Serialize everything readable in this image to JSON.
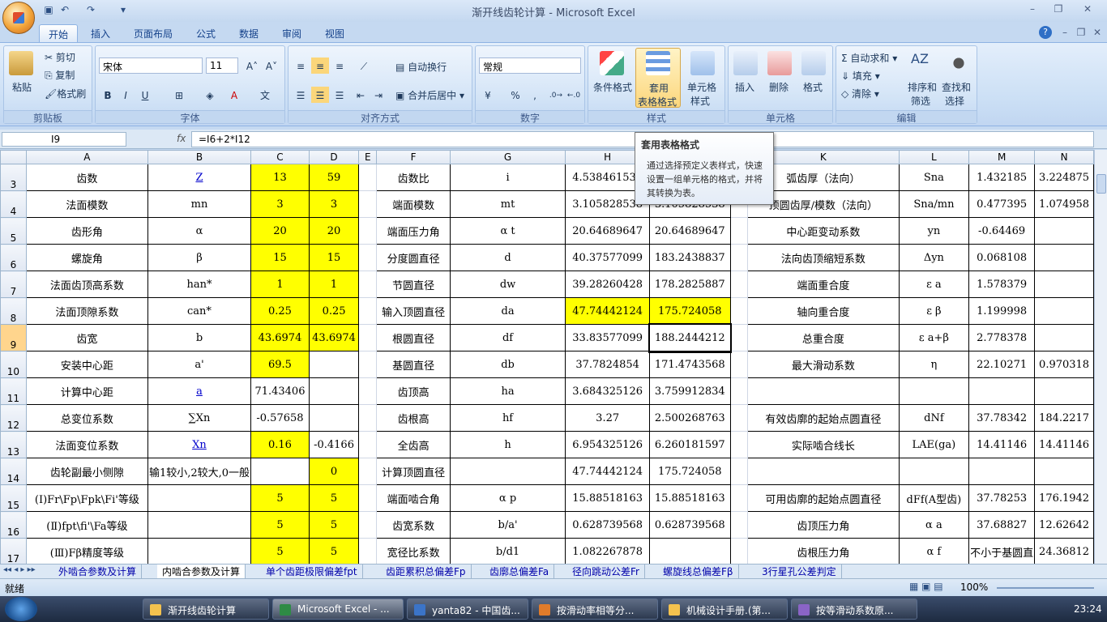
{
  "title": "渐开线齿轮计算 - Microsoft Excel",
  "tabs": [
    "开始",
    "插入",
    "页面布局",
    "公式",
    "数据",
    "审阅",
    "视图"
  ],
  "clipboard": {
    "paste": "粘贴",
    "cut": "剪切",
    "copy": "复制",
    "format_painter": "格式刷",
    "label": "剪贴板"
  },
  "font": {
    "name": "宋体",
    "size": "11",
    "label": "字体",
    "bold": "B",
    "italic": "I",
    "underline": "U"
  },
  "alignment": {
    "wrap": "自动换行",
    "merge": "合并后居中",
    "label": "对齐方式"
  },
  "number": {
    "format": "常规",
    "label": "数字",
    "percent": "%",
    "comma": ","
  },
  "styles": {
    "cond": "条件格式",
    "table1": "套用",
    "table2": "表格格式",
    "cell1": "单元格",
    "cell2": "样式",
    "label": "样式"
  },
  "cells": {
    "insert": "插入",
    "delete": "删除",
    "format": "格式",
    "label": "单元格"
  },
  "editing": {
    "autosum": "自动求和",
    "fill": "填充",
    "clear": "清除",
    "sort1": "排序和",
    "sort2": "筛选",
    "find1": "查找和",
    "find2": "选择",
    "label": "编辑"
  },
  "tooltip": {
    "title": "套用表格格式",
    "body": "通过选择预定义表样式，快速设置一组单元格的格式，并将其转换为表。"
  },
  "namebox": "I9",
  "formula": "=I6+2*I12",
  "columns": [
    "A",
    "B",
    "C",
    "D",
    "E",
    "F",
    "G",
    "H",
    "I",
    "J",
    "K",
    "L",
    "M",
    "N"
  ],
  "rows": [
    {
      "n": "3",
      "c": [
        "齿数",
        "Z",
        "13",
        "59",
        "",
        "齿数比",
        "i",
        "4.538461538",
        "",
        "",
        "弧齿厚（法向）",
        "Sna",
        "1.432185",
        "3.224875"
      ]
    },
    {
      "n": "4",
      "c": [
        "法面模数",
        "mn",
        "3",
        "3",
        "",
        "端面模数",
        "mt",
        "3.105828538",
        "3.105828538",
        "",
        "顶圆齿厚/模数（法向）",
        "Sna/mn",
        "0.477395",
        "1.074958"
      ]
    },
    {
      "n": "5",
      "c": [
        "齿形角",
        "α",
        "20",
        "20",
        "",
        "端面压力角",
        "α t",
        "20.64689647",
        "20.64689647",
        "",
        "中心距变动系数",
        "yn",
        "-0.64469",
        ""
      ]
    },
    {
      "n": "6",
      "c": [
        "螺旋角",
        "β",
        "15",
        "15",
        "",
        "分度圆直径",
        "d",
        "40.37577099",
        "183.2438837",
        "",
        "法向齿顶缩短系数",
        "Δyn",
        "0.068108",
        ""
      ]
    },
    {
      "n": "7",
      "c": [
        "法面齿顶高系数",
        "han*",
        "1",
        "1",
        "",
        "节圆直径",
        "dw",
        "39.28260428",
        "178.2825887",
        "",
        "端面重合度",
        "ε a",
        "1.578379",
        ""
      ]
    },
    {
      "n": "8",
      "c": [
        "法面顶隙系数",
        "can*",
        "0.25",
        "0.25",
        "",
        "输入顶圆直径",
        "da",
        "47.74442124",
        "175.724058",
        "",
        "轴向重合度",
        "ε β",
        "1.199998",
        ""
      ]
    },
    {
      "n": "9",
      "c": [
        "齿宽",
        "b",
        "43.6974",
        "43.6974",
        "",
        "根圆直径",
        "df",
        "33.83577099",
        "188.2444212",
        "",
        "总重合度",
        "ε a+β",
        "2.778378",
        ""
      ]
    },
    {
      "n": "10",
      "c": [
        "安装中心距",
        "a'",
        "69.5",
        "",
        "",
        "基圆直径",
        "db",
        "37.7824854",
        "171.4743568",
        "",
        "最大滑动系数",
        "η",
        "22.10271",
        "0.970318"
      ]
    },
    {
      "n": "11",
      "c": [
        "计算中心距",
        "a",
        "71.43406",
        "",
        "",
        "齿顶高",
        "ha",
        "3.684325126",
        "3.759912834",
        "",
        "",
        "",
        "",
        ""
      ]
    },
    {
      "n": "12",
      "c": [
        "总变位系数",
        "∑Xn",
        "-0.57658",
        "",
        "",
        "齿根高",
        "hf",
        "3.27",
        "2.500268763",
        "",
        "有效齿廓的起始点圆直径",
        "dNf",
        "37.78342",
        "184.2217"
      ]
    },
    {
      "n": "13",
      "c": [
        "法面变位系数",
        "Xn",
        "0.16",
        "-0.4166",
        "",
        "全齿高",
        "h",
        "6.954325126",
        "6.260181597",
        "",
        "实际啮合线长",
        "LAE(ga)",
        "14.41146",
        "14.41146"
      ]
    },
    {
      "n": "14",
      "c": [
        "齿轮副最小侧隙",
        "输1较小,2较大,0一般",
        "",
        "0",
        "",
        "计算顶圆直径",
        "",
        "47.74442124",
        "175.724058",
        "",
        "",
        "",
        "",
        ""
      ]
    },
    {
      "n": "15",
      "c": [
        "(Ⅰ)Fr\\Fp\\Fpk\\Fi'等级",
        "",
        "5",
        "5",
        "",
        "端面啮合角",
        "α p",
        "15.88518163",
        "15.88518163",
        "",
        "可用齿廓的起始点圆直径",
        "dFf(A型齿)",
        "37.78253",
        "176.1942"
      ]
    },
    {
      "n": "16",
      "c": [
        "(Ⅱ)fpt\\fi'\\Fa等级",
        "",
        "5",
        "5",
        "",
        "齿宽系数",
        "b/a'",
        "0.628739568",
        "0.628739568",
        "",
        "齿顶压力角",
        "α a",
        "37.68827",
        "12.62642"
      ]
    },
    {
      "n": "17",
      "c": [
        "(Ⅲ)Fβ精度等级",
        "",
        "5",
        "5",
        "",
        "宽径比系数",
        "b/d1",
        "1.082267878",
        "",
        "",
        "齿根压力角",
        "α f",
        "不小于基圆直",
        "24.36812"
      ]
    }
  ],
  "sheet_tabs": [
    "外啮合参数及计算",
    "内啮合参数及计算",
    "单个齿距极限偏差fpt",
    "齿距累积总偏差Fp",
    "齿廓总偏差Fa",
    "径向跳动公差Fr",
    "螺旋线总偏差Fβ",
    "3行星孔公差判定"
  ],
  "status": {
    "ready": "就绪",
    "zoom": "100%"
  },
  "taskbar": {
    "items": [
      "渐开线齿轮计算",
      "Microsoft Excel - ...",
      "yanta82 - 中国齿...",
      "按滑动率相等分...",
      "机械设计手册.(第...",
      "按等滑动系数原..."
    ],
    "time": "23:24"
  }
}
